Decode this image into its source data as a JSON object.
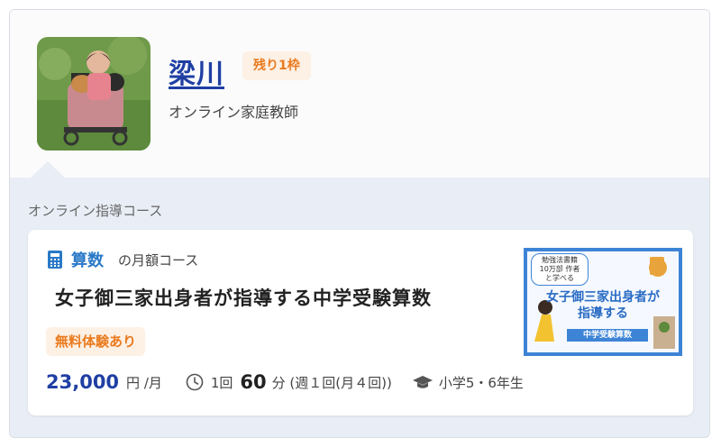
{
  "tutor": {
    "name": "梁川",
    "remaining_badge": "残り1枠",
    "role": "オンライン家庭教師"
  },
  "section": {
    "title": "オンライン指導コース"
  },
  "course": {
    "subject": "算数",
    "type": "の月額コース",
    "title": "女子御三家出身者が指導する中学受験算数",
    "trial_badge": "無料体験あり",
    "price": "23,000",
    "price_unit": "円 /月",
    "lesson_count": "1回",
    "duration": "60",
    "duration_detail": "分 (週１回(月４回))",
    "grade": "小学5・6年生",
    "thumbnail": {
      "tag": "勉強法書籍10万部 作者と学べる",
      "title_line1": "女子御三家出身者が",
      "title_line2": "指導する",
      "band": "中学受験算数"
    }
  },
  "colors": {
    "accent_blue": "#1f3fa3",
    "subject_blue": "#2a79c7",
    "badge_orange": "#ea7a1e",
    "badge_bg": "#fdf0e4",
    "section_bg": "#e9eef6"
  },
  "icons": {
    "subject": "calculator-icon",
    "duration": "clock-icon",
    "grade": "graduation-cap-icon"
  }
}
